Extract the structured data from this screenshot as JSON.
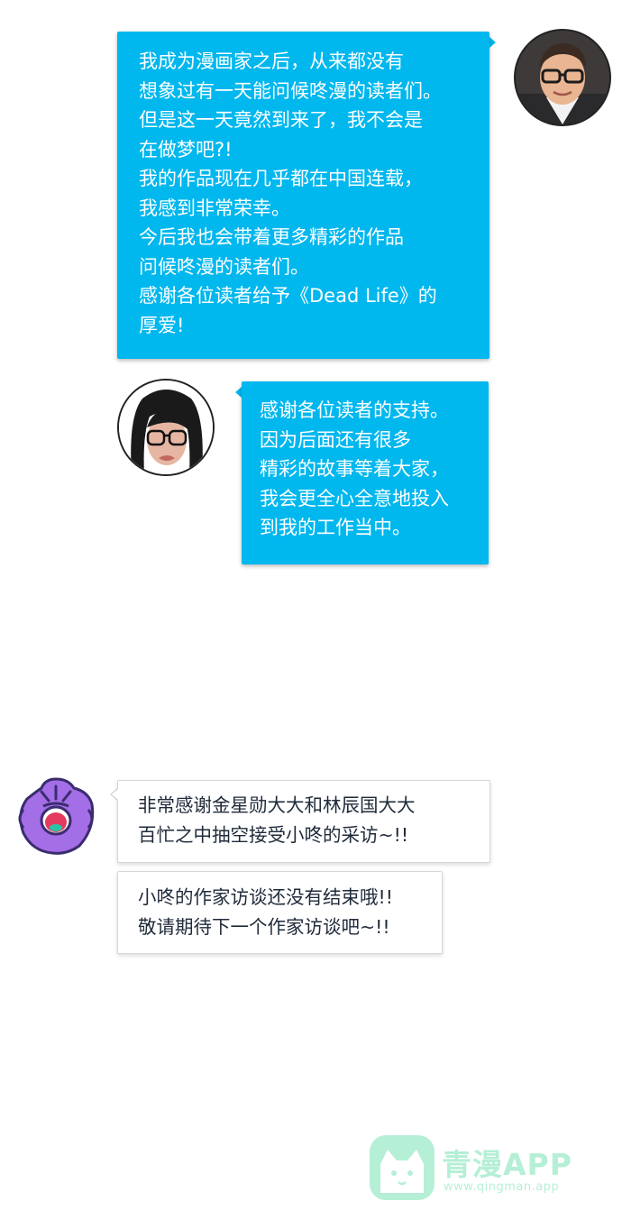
{
  "messages": [
    {
      "id": "author",
      "text": "我成为漫画家之后，从来都没有\n想象过有一天能问候咚漫的读者们。\n但是这一天竟然到来了，我不会是\n在做梦吧?!\n我的作品现在几乎都在中国连载，\n我感到非常荣幸。\n今后我也会带着更多精彩的作品\n问候咚漫的读者们。\n感谢各位读者给予《Dead Life》的\n厚爱!"
    },
    {
      "id": "artist",
      "text": "感谢各位读者的支持。\n因为后面还有很多\n精彩的故事等着大家，\n我会更全心全意地投入\n到我的工作当中。"
    },
    {
      "id": "mascot-1",
      "text": "非常感谢金星勋大大和林辰国大大\n百忙之中抽空接受小咚的采访~!!"
    },
    {
      "id": "mascot-2",
      "text": "小咚的作家访谈还没有结束哦!!\n敬请期待下一个作家访谈吧~!!"
    }
  ],
  "colors": {
    "bubble_blue": "#00b7ee",
    "mascot_purple": "#a46ee6",
    "watermark_green": "#2fd38a"
  },
  "watermark": {
    "title": "青漫APP",
    "url": "www.qingman.app"
  }
}
